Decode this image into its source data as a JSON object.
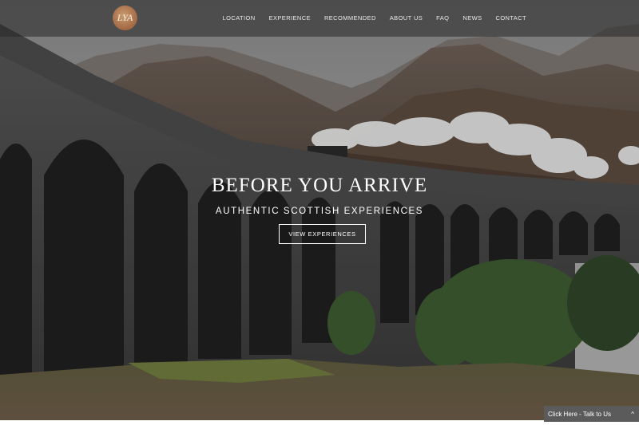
{
  "header": {
    "logo_text": "LYA",
    "nav": [
      "LOCATION",
      "EXPERIENCE",
      "RECOMMENDED",
      "ABOUT US",
      "FAQ",
      "NEWS",
      "CONTACT"
    ]
  },
  "hero": {
    "title": "BEFORE YOU ARRIVE",
    "subtitle": "AUTHENTIC SCOTTISH EXPERIENCES",
    "button_label": "VIEW EXPERIENCES"
  },
  "chat": {
    "label": "Click Here - Talk to Us",
    "chevron": "^"
  },
  "colors": {
    "nav_bg": "#2d2d2d",
    "logo": "#a8704a",
    "chat_bg": "#5b5b5b"
  }
}
